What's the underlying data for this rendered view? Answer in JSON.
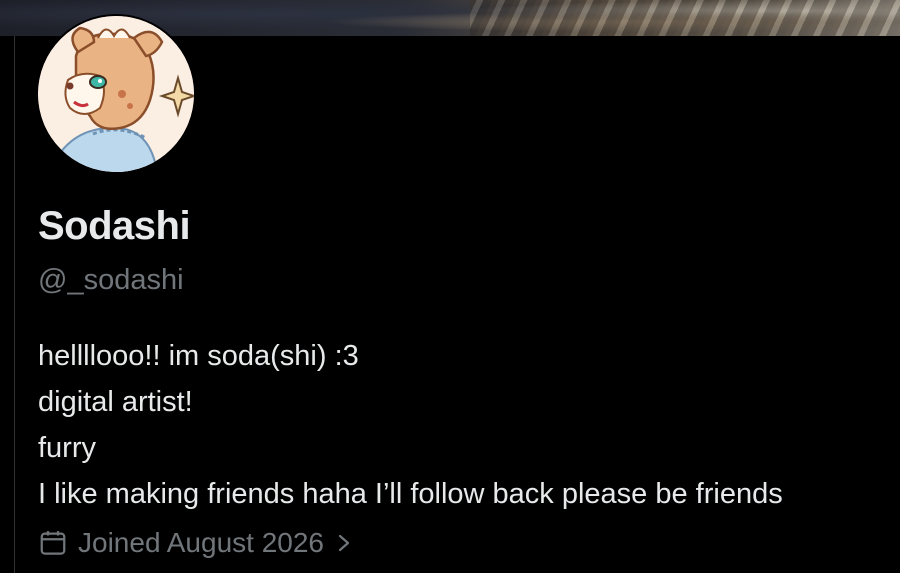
{
  "profile": {
    "display_name": "Sodashi",
    "handle": "@_sodashi",
    "bio_lines": [
      "hellllooo!! im soda(shi) :3",
      "digital artist!",
      "furry",
      "I like making friends haha I’ll follow back please be friends"
    ],
    "joined": "Joined August 2026",
    "joined_icon": "calendar-icon",
    "chevron_icon": "chevron-right-icon"
  },
  "colors": {
    "background": "#000000",
    "primary_text": "#e7e9ea",
    "secondary_text": "#71767b"
  }
}
